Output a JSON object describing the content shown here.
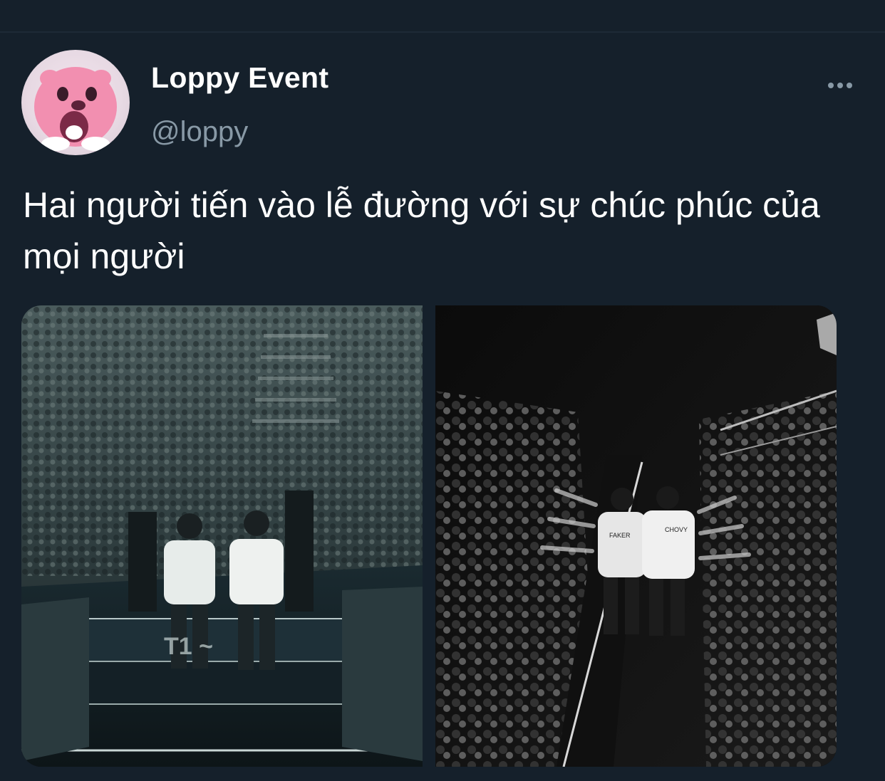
{
  "tweet": {
    "display_name": "Loppy Event",
    "handle": "@loppy",
    "text": "Hai người tiến vào lễ đường với sự chúc phúc của mọi người",
    "more_icon": "more-horizontal-icon"
  },
  "media": {
    "left_jersey_text": "",
    "right_jersey_left": "FAKER",
    "right_jersey_right": "CHOVY"
  },
  "colors": {
    "background": "#15202b",
    "secondary_text": "#8899a6",
    "primary_text": "#ffffff"
  }
}
